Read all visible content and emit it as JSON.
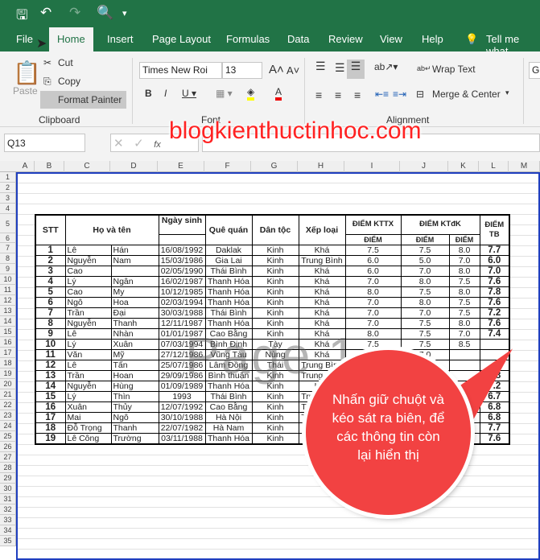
{
  "quick_access": {
    "icons": [
      "save-icon",
      "undo-icon",
      "redo-icon",
      "print-preview-icon",
      "customize-icon"
    ]
  },
  "tabs": [
    "File",
    "Home",
    "Insert",
    "Page Layout",
    "Formulas",
    "Data",
    "Review",
    "View",
    "Help",
    "Tell me what"
  ],
  "ribbon": {
    "paste": "Paste",
    "cut": "Cut",
    "copy": "Copy",
    "format_painter": "Format Painter",
    "clipboard": "Clipboard",
    "font_name": "Times New Roi",
    "font_size": "13",
    "font_group": "Font",
    "wrap_text": "Wrap Text",
    "merge_center": "Merge & Center",
    "alignment": "Alignment",
    "number_format": "G"
  },
  "formula_bar": {
    "name_box": "Q13",
    "fx": "fx"
  },
  "columns": [
    "A",
    "B",
    "C",
    "D",
    "E",
    "F",
    "G",
    "H",
    "I",
    "J",
    "K",
    "L",
    "M"
  ],
  "rows": [
    "1",
    "2",
    "3",
    "4",
    "5",
    "6",
    "7",
    "8",
    "9",
    "10",
    "11",
    "12",
    "13",
    "14",
    "15",
    "16",
    "17",
    "18",
    "19",
    "20",
    "21",
    "22",
    "23",
    "24",
    "25",
    "26",
    "27",
    "28",
    "29",
    "30",
    "31",
    "32",
    "33",
    "34",
    "35"
  ],
  "table": {
    "headers": {
      "stt": "STT",
      "name": "Họ và tên",
      "dob": "Ngày sinh",
      "hometown": "Quê quán",
      "ethnicity": "Dân tộc",
      "rank": "Xếp loại",
      "kttx": "ĐIỂM KTTX",
      "ktdk": "ĐIỂM KTđK",
      "tb": "ĐIỂM TB",
      "diem": "ĐIỂM"
    },
    "rows": [
      [
        "1",
        "Lê",
        "Hán",
        "16/08/1992",
        "Daklak",
        "Kinh",
        "Khá",
        "7.5",
        "7.5",
        "8.0",
        "7.7"
      ],
      [
        "2",
        "Nguyễn",
        "Nam",
        "15/03/1986",
        "Gia Lai",
        "Kinh",
        "Trung Bình",
        "6.0",
        "5.0",
        "7.0",
        "6.0"
      ],
      [
        "3",
        "Cao",
        "",
        "02/05/1990",
        "Thái Bình",
        "Kinh",
        "Khá",
        "6.0",
        "7.0",
        "8.0",
        "7.0"
      ],
      [
        "4",
        "Lý",
        "Ngân",
        "16/02/1987",
        "Thanh Hóa",
        "Kinh",
        "Khá",
        "7.0",
        "8.0",
        "7.5",
        "7.6"
      ],
      [
        "5",
        "Cao",
        "My",
        "10/12/1985",
        "Thanh Hóa",
        "Kinh",
        "Khá",
        "8.0",
        "7.5",
        "8.0",
        "7.8"
      ],
      [
        "6",
        "Ngô",
        "Hoa",
        "02/03/1994",
        "Thanh Hóa",
        "Kinh",
        "Khá",
        "7.0",
        "8.0",
        "7.5",
        "7.6"
      ],
      [
        "7",
        "Trần",
        "Đại",
        "30/03/1988",
        "Thái Bình",
        "Kinh",
        "Khá",
        "7.0",
        "7.0",
        "7.5",
        "7.2"
      ],
      [
        "8",
        "Nguyễn",
        "Thanh",
        "12/11/1987",
        "Thanh Hóa",
        "Kinh",
        "Khá",
        "7.0",
        "7.5",
        "8.0",
        "7.6"
      ],
      [
        "9",
        "Lê",
        "Nhàn",
        "01/01/1987",
        "Cao Bằng",
        "Kinh",
        "Khá",
        "8.0",
        "7.5",
        "7.0",
        "7.4"
      ],
      [
        "10",
        "Lý",
        "Xuân",
        "07/03/1994",
        "Bình Định",
        "Tày",
        "Khá",
        "7.5",
        "7.5",
        "8.5",
        ""
      ],
      [
        "11",
        "Văn",
        "Mỹ",
        "27/12/1986",
        "Vũng Tàu",
        "Nùng",
        "Khá",
        "7.0",
        "7.0",
        "",
        ""
      ],
      [
        "12",
        "Lê",
        "Tấn",
        "25/07/1986",
        "Lâm Đồng",
        "Thái",
        "Trung Bình",
        "",
        "",
        "",
        ""
      ],
      [
        "13",
        "Trần",
        "Hoan",
        "29/09/1986",
        "Bình thuận",
        "Kinh",
        "Trung Bình",
        "",
        "",
        "",
        "6.8"
      ],
      [
        "14",
        "Nguyễn",
        "Hùng",
        "01/09/1989",
        "Thanh Hóa",
        "Kinh",
        "Khá",
        "",
        "",
        "",
        "7.2"
      ],
      [
        "15",
        "Lý",
        "Thìn",
        "1993",
        "Thái Bình",
        "Kinh",
        "Trung Bình",
        "",
        "",
        "",
        "6.7"
      ],
      [
        "16",
        "Xuân",
        "Thủy",
        "12/07/1992",
        "Cao Bằng",
        "Kinh",
        "Trung Bình",
        "",
        "",
        "",
        "6.8"
      ],
      [
        "17",
        "Mai",
        "Ngô",
        "30/10/1988",
        "Hà Nội",
        "Kinh",
        "Trung Bình",
        "",
        "",
        "",
        "6.8"
      ],
      [
        "18",
        "Đỗ Trọng",
        "Thanh",
        "22/07/1982",
        "Hà Nam",
        "Kinh",
        "",
        "",
        "",
        "",
        "7.7"
      ],
      [
        "19",
        "Lê Công",
        "Trường",
        "03/11/1988",
        "Thanh Hóa",
        "Kinh",
        "",
        "",
        "",
        "",
        "7.6"
      ]
    ]
  },
  "watermark": "Page 1",
  "brand": "blogkienthuctinhoc.com",
  "callout": "Nhấn giữ chuột và kéo sát ra biên, để các thông tin còn lại hiển thị",
  "colors": {
    "excel_green": "#217346",
    "callout": "#f24242",
    "page_border": "#1f3fbf"
  }
}
